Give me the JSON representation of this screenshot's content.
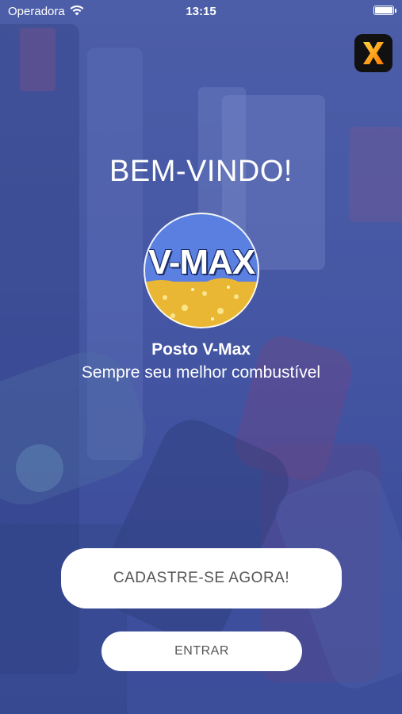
{
  "status_bar": {
    "carrier": "Operadora",
    "time": "13:15"
  },
  "welcome": {
    "title": "BEM-VINDO!"
  },
  "logo": {
    "text": "V-MAX"
  },
  "station": {
    "name": "Posto V-Max",
    "tagline": "Sempre seu melhor combustível"
  },
  "buttons": {
    "register_label": "CADASTRE-SE AGORA!",
    "login_label": "ENTRAR"
  },
  "colors": {
    "overlay": "#4052aa",
    "logo_sky": "#5b80e2",
    "logo_fuel": "#f1c84d",
    "button_bg": "#ffffff",
    "button_text": "#555555"
  }
}
